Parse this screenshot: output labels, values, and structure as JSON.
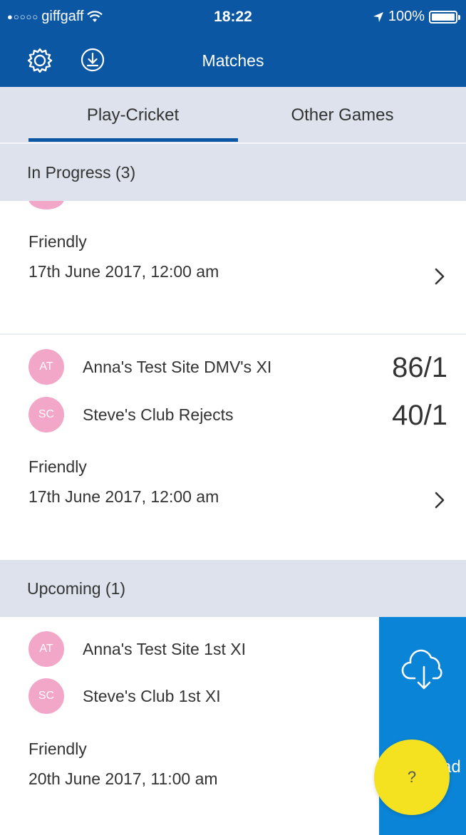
{
  "status_bar": {
    "carrier": "giffgaff",
    "signal_dots": "●○○○○",
    "time": "18:22",
    "battery": "100%"
  },
  "nav": {
    "title": "Matches"
  },
  "tabs": [
    {
      "label": "Play-Cricket",
      "active": true
    },
    {
      "label": "Other Games",
      "active": false
    }
  ],
  "sections": {
    "in_progress": {
      "header": "In Progress (3)",
      "matches": [
        {
          "type": "Friendly",
          "date": "17th June 2017, 12:00 am"
        },
        {
          "teams": [
            {
              "initials": "AT",
              "name": "Anna's Test Site DMV's XI",
              "score": "86/1"
            },
            {
              "initials": "SC",
              "name": "Steve's Club Rejects",
              "score": "40/1"
            }
          ],
          "type": "Friendly",
          "date": "17th June 2017, 12:00 am"
        }
      ]
    },
    "upcoming": {
      "header": "Upcoming (1)",
      "matches": [
        {
          "teams": [
            {
              "initials": "AT",
              "name": "Anna's Test Site 1st XI"
            },
            {
              "initials": "SC",
              "name": "Steve's Club 1st XI"
            }
          ],
          "type": "Friendly",
          "date": "20th June 2017, 11:00 am"
        }
      ]
    }
  },
  "download_panel": {
    "label": "ad"
  },
  "help_button": {
    "label": "?"
  },
  "colors": {
    "nav_blue": "#0b57a4",
    "section_grey": "#dde2ec",
    "avatar_pink": "#f3a7c8",
    "download_blue": "#0a84d6",
    "help_yellow": "#f4e220"
  }
}
